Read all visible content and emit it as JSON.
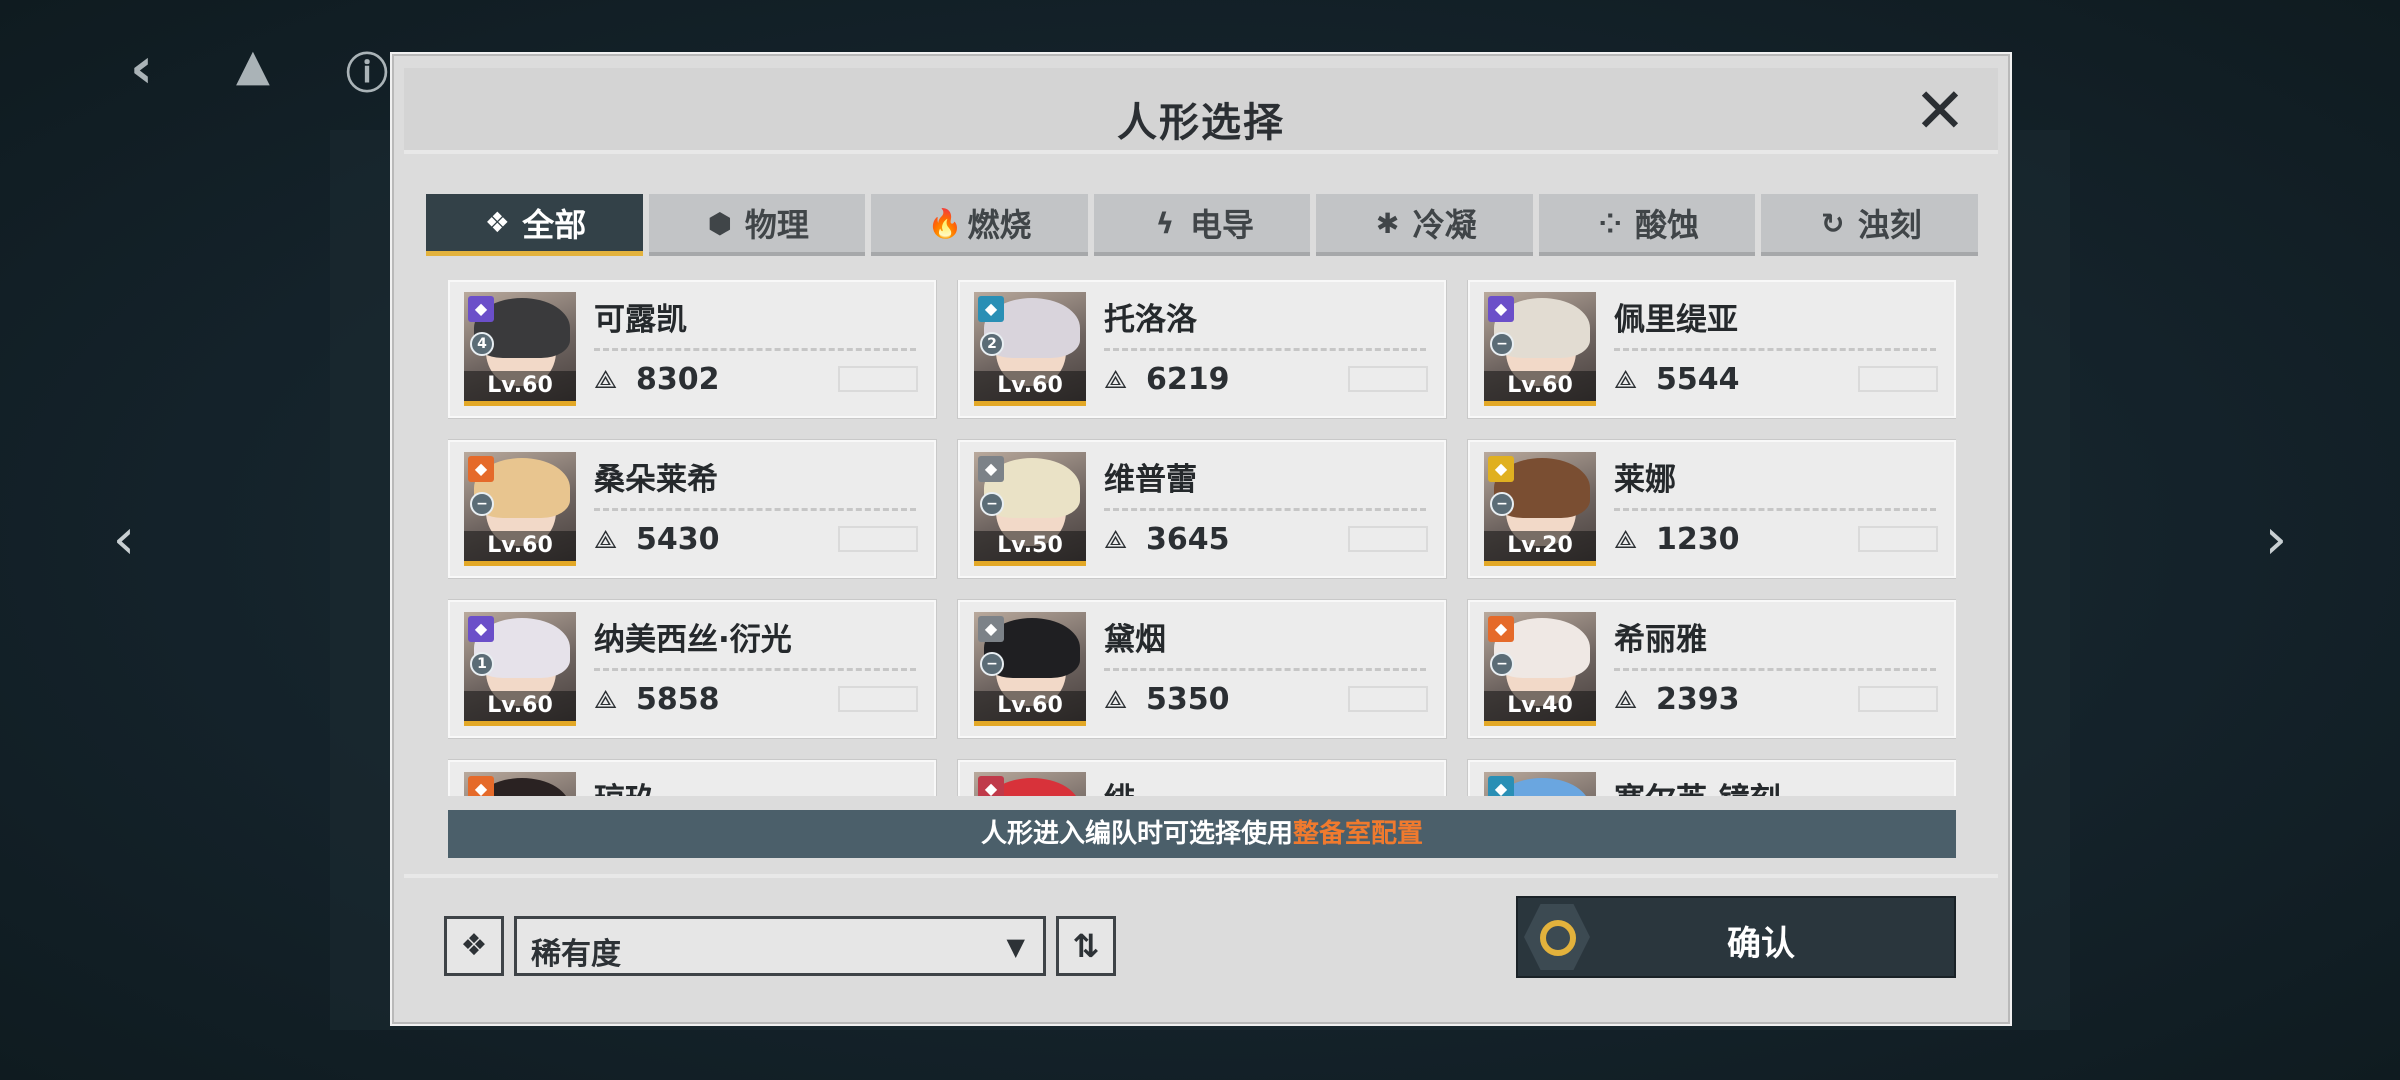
{
  "background": {
    "back_icon": "chevron-left-icon",
    "left_arrow": "‹",
    "right_arrow": "›"
  },
  "dialog": {
    "title": "人形选择",
    "close_icon": "close-icon"
  },
  "tabs": [
    {
      "label": "全部",
      "icon": "❖",
      "active": true
    },
    {
      "label": "物理",
      "icon": "⬢",
      "active": false
    },
    {
      "label": "燃烧",
      "icon": "🔥",
      "active": false
    },
    {
      "label": "电导",
      "icon": "ϟ",
      "active": false
    },
    {
      "label": "冷凝",
      "icon": "✱",
      "active": false
    },
    {
      "label": "酸蚀",
      "icon": "⁘",
      "active": false
    },
    {
      "label": "浊刻",
      "icon": "↻",
      "active": false
    }
  ],
  "characters": [
    {
      "name": "可露凯",
      "level": "Lv.60",
      "power": "8302",
      "rank": "4",
      "element": "acid",
      "elem_color": "#6b4fc9",
      "hair": "#3a3a3c"
    },
    {
      "name": "托洛洛",
      "level": "Lv.60",
      "power": "6219",
      "rank": "2",
      "element": "corrosion",
      "elem_color": "#2a8fb5",
      "hair": "#d9d4dc"
    },
    {
      "name": "佩里缇亚",
      "level": "Lv.60",
      "power": "5544",
      "rank": "−",
      "element": "acid",
      "elem_color": "#6b4fc9",
      "hair": "#e2dcd2"
    },
    {
      "name": "桑朵莱希",
      "level": "Lv.60",
      "power": "5430",
      "rank": "−",
      "element": "burn",
      "elem_color": "#e56a2a",
      "hair": "#e8c58f"
    },
    {
      "name": "维普蕾",
      "level": "Lv.50",
      "power": "3645",
      "rank": "−",
      "element": "physical",
      "elem_color": "#7c8288",
      "hair": "#eae2c6"
    },
    {
      "name": "莱娜",
      "level": "Lv.20",
      "power": "1230",
      "rank": "−",
      "element": "electric",
      "elem_color": "#e0b020",
      "hair": "#7a4e32"
    },
    {
      "name": "纳美西丝·衍光",
      "level": "Lv.60",
      "power": "5858",
      "rank": "1",
      "element": "acid",
      "elem_color": "#6b4fc9",
      "hair": "#e6e2ea"
    },
    {
      "name": "黛烟",
      "level": "Lv.60",
      "power": "5350",
      "rank": "−",
      "element": "physical",
      "elem_color": "#7c8288",
      "hair": "#1f1f22"
    },
    {
      "name": "希丽雅",
      "level": "Lv.40",
      "power": "2393",
      "rank": "−",
      "element": "burn",
      "elem_color": "#e56a2a",
      "hair": "#efe8e4"
    },
    {
      "name": "琼玖",
      "level": "",
      "power": "",
      "rank": "",
      "element": "burn",
      "elem_color": "#e56a2a",
      "hair": "#2a2222"
    },
    {
      "name": "绯",
      "level": "",
      "power": "",
      "rank": "",
      "element": "physical",
      "elem_color": "#c03a4a",
      "hair": "#d8323a"
    },
    {
      "name": "塞尔芙·镜刻",
      "level": "",
      "power": "",
      "rank": "",
      "element": "corrosion",
      "elem_color": "#2a8fb5",
      "hair": "#6aa6e0"
    }
  ],
  "notice": {
    "text": "人形进入编队时可选择使用",
    "highlight": "整备室配置"
  },
  "controls": {
    "filter_icon": "❖",
    "sort_label": "稀有度",
    "sort_caret": "▼",
    "order_icon": "⇅",
    "confirm_label": "确认"
  },
  "colors": {
    "accent_gold": "#e3b23c",
    "tab_active_bg": "#334148",
    "notice_bg": "#4b5f6a",
    "notice_highlight": "#f07a2e"
  }
}
